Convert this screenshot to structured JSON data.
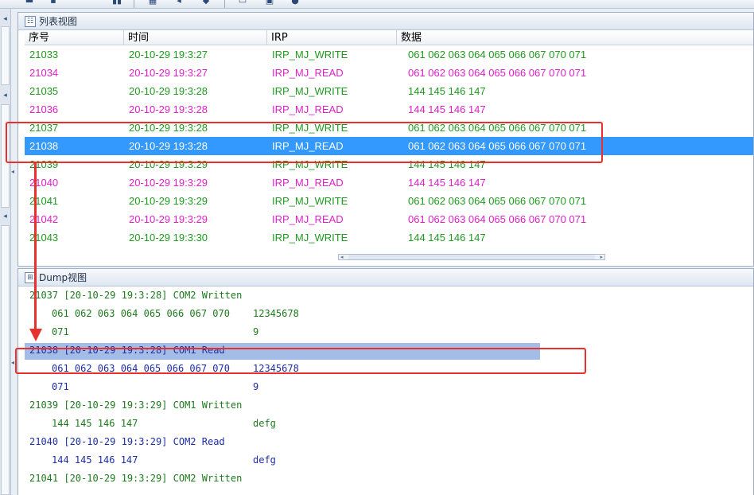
{
  "list_panel": {
    "title": "列表视图",
    "columns": [
      "序号",
      "时间",
      "IRP",
      "数据"
    ],
    "rows": [
      {
        "seq": "21033",
        "time": "20-10-29 19:3:27",
        "irp": "IRP_MJ_WRITE",
        "data": "061 062 063 064 065 066 067 070 071",
        "kind": "write"
      },
      {
        "seq": "21034",
        "time": "20-10-29 19:3:27",
        "irp": "IRP_MJ_READ",
        "data": "061 062 063 064 065 066 067 070 071",
        "kind": "read"
      },
      {
        "seq": "21035",
        "time": "20-10-29 19:3:28",
        "irp": "IRP_MJ_WRITE",
        "data": "144 145 146 147",
        "kind": "write"
      },
      {
        "seq": "21036",
        "time": "20-10-29 19:3:28",
        "irp": "IRP_MJ_READ",
        "data": "144 145 146 147",
        "kind": "read"
      },
      {
        "seq": "21037",
        "time": "20-10-29 19:3:28",
        "irp": "IRP_MJ_WRITE",
        "data": "061 062 063 064 065 066 067 070 071",
        "kind": "write"
      },
      {
        "seq": "21038",
        "time": "20-10-29 19:3:28",
        "irp": "IRP_MJ_READ",
        "data": "061 062 063 064 065 066 067 070 071",
        "kind": "selected"
      },
      {
        "seq": "21039",
        "time": "20-10-29 19:3:29",
        "irp": "IRP_MJ_WRITE",
        "data": "144 145 146 147",
        "kind": "write"
      },
      {
        "seq": "21040",
        "time": "20-10-29 19:3:29",
        "irp": "IRP_MJ_READ",
        "data": "144 145 146 147",
        "kind": "read"
      },
      {
        "seq": "21041",
        "time": "20-10-29 19:3:29",
        "irp": "IRP_MJ_WRITE",
        "data": "061 062 063 064 065 066 067 070 071",
        "kind": "write"
      },
      {
        "seq": "21042",
        "time": "20-10-29 19:3:29",
        "irp": "IRP_MJ_READ",
        "data": "061 062 063 064 065 066 067 070 071",
        "kind": "read"
      },
      {
        "seq": "21043",
        "time": "20-10-29 19:3:30",
        "irp": "IRP_MJ_WRITE",
        "data": "144 145 146 147",
        "kind": "write"
      }
    ]
  },
  "dump_panel": {
    "title": "Dump视图",
    "lines": [
      {
        "head": "21037 [20-10-29 19:3:28] COM2 Written",
        "color": "green"
      },
      {
        "hex": "061 062 063 064 065 066 067 070",
        "ascii": "12345678",
        "color": "green"
      },
      {
        "hex": "071",
        "ascii": "9",
        "color": "green"
      },
      {
        "head": "21038 [20-10-29 19:3:28] COM1 Read",
        "color": "blue",
        "selected": true
      },
      {
        "hex": "061 062 063 064 065 066 067 070",
        "ascii": "12345678",
        "color": "blue"
      },
      {
        "hex": "071",
        "ascii": "9",
        "color": "blue"
      },
      {
        "head": "21039 [20-10-29 19:3:29] COM1 Written",
        "color": "green"
      },
      {
        "hex": "144 145 146 147",
        "ascii": "defg",
        "color": "green"
      },
      {
        "head": "21040 [20-10-29 19:3:29] COM2 Read",
        "color": "blue"
      },
      {
        "hex": "144 145 146 147",
        "ascii": "defg",
        "color": "blue"
      },
      {
        "head": "21041 [20-10-29 19:3:29] COM2 Written",
        "color": "green"
      }
    ]
  },
  "colors": {
    "write": "#1f9a1f",
    "read": "#e020c8",
    "selection": "#3399ff",
    "dump_selection": "#a4bde6",
    "annotation": "#e8302c"
  }
}
